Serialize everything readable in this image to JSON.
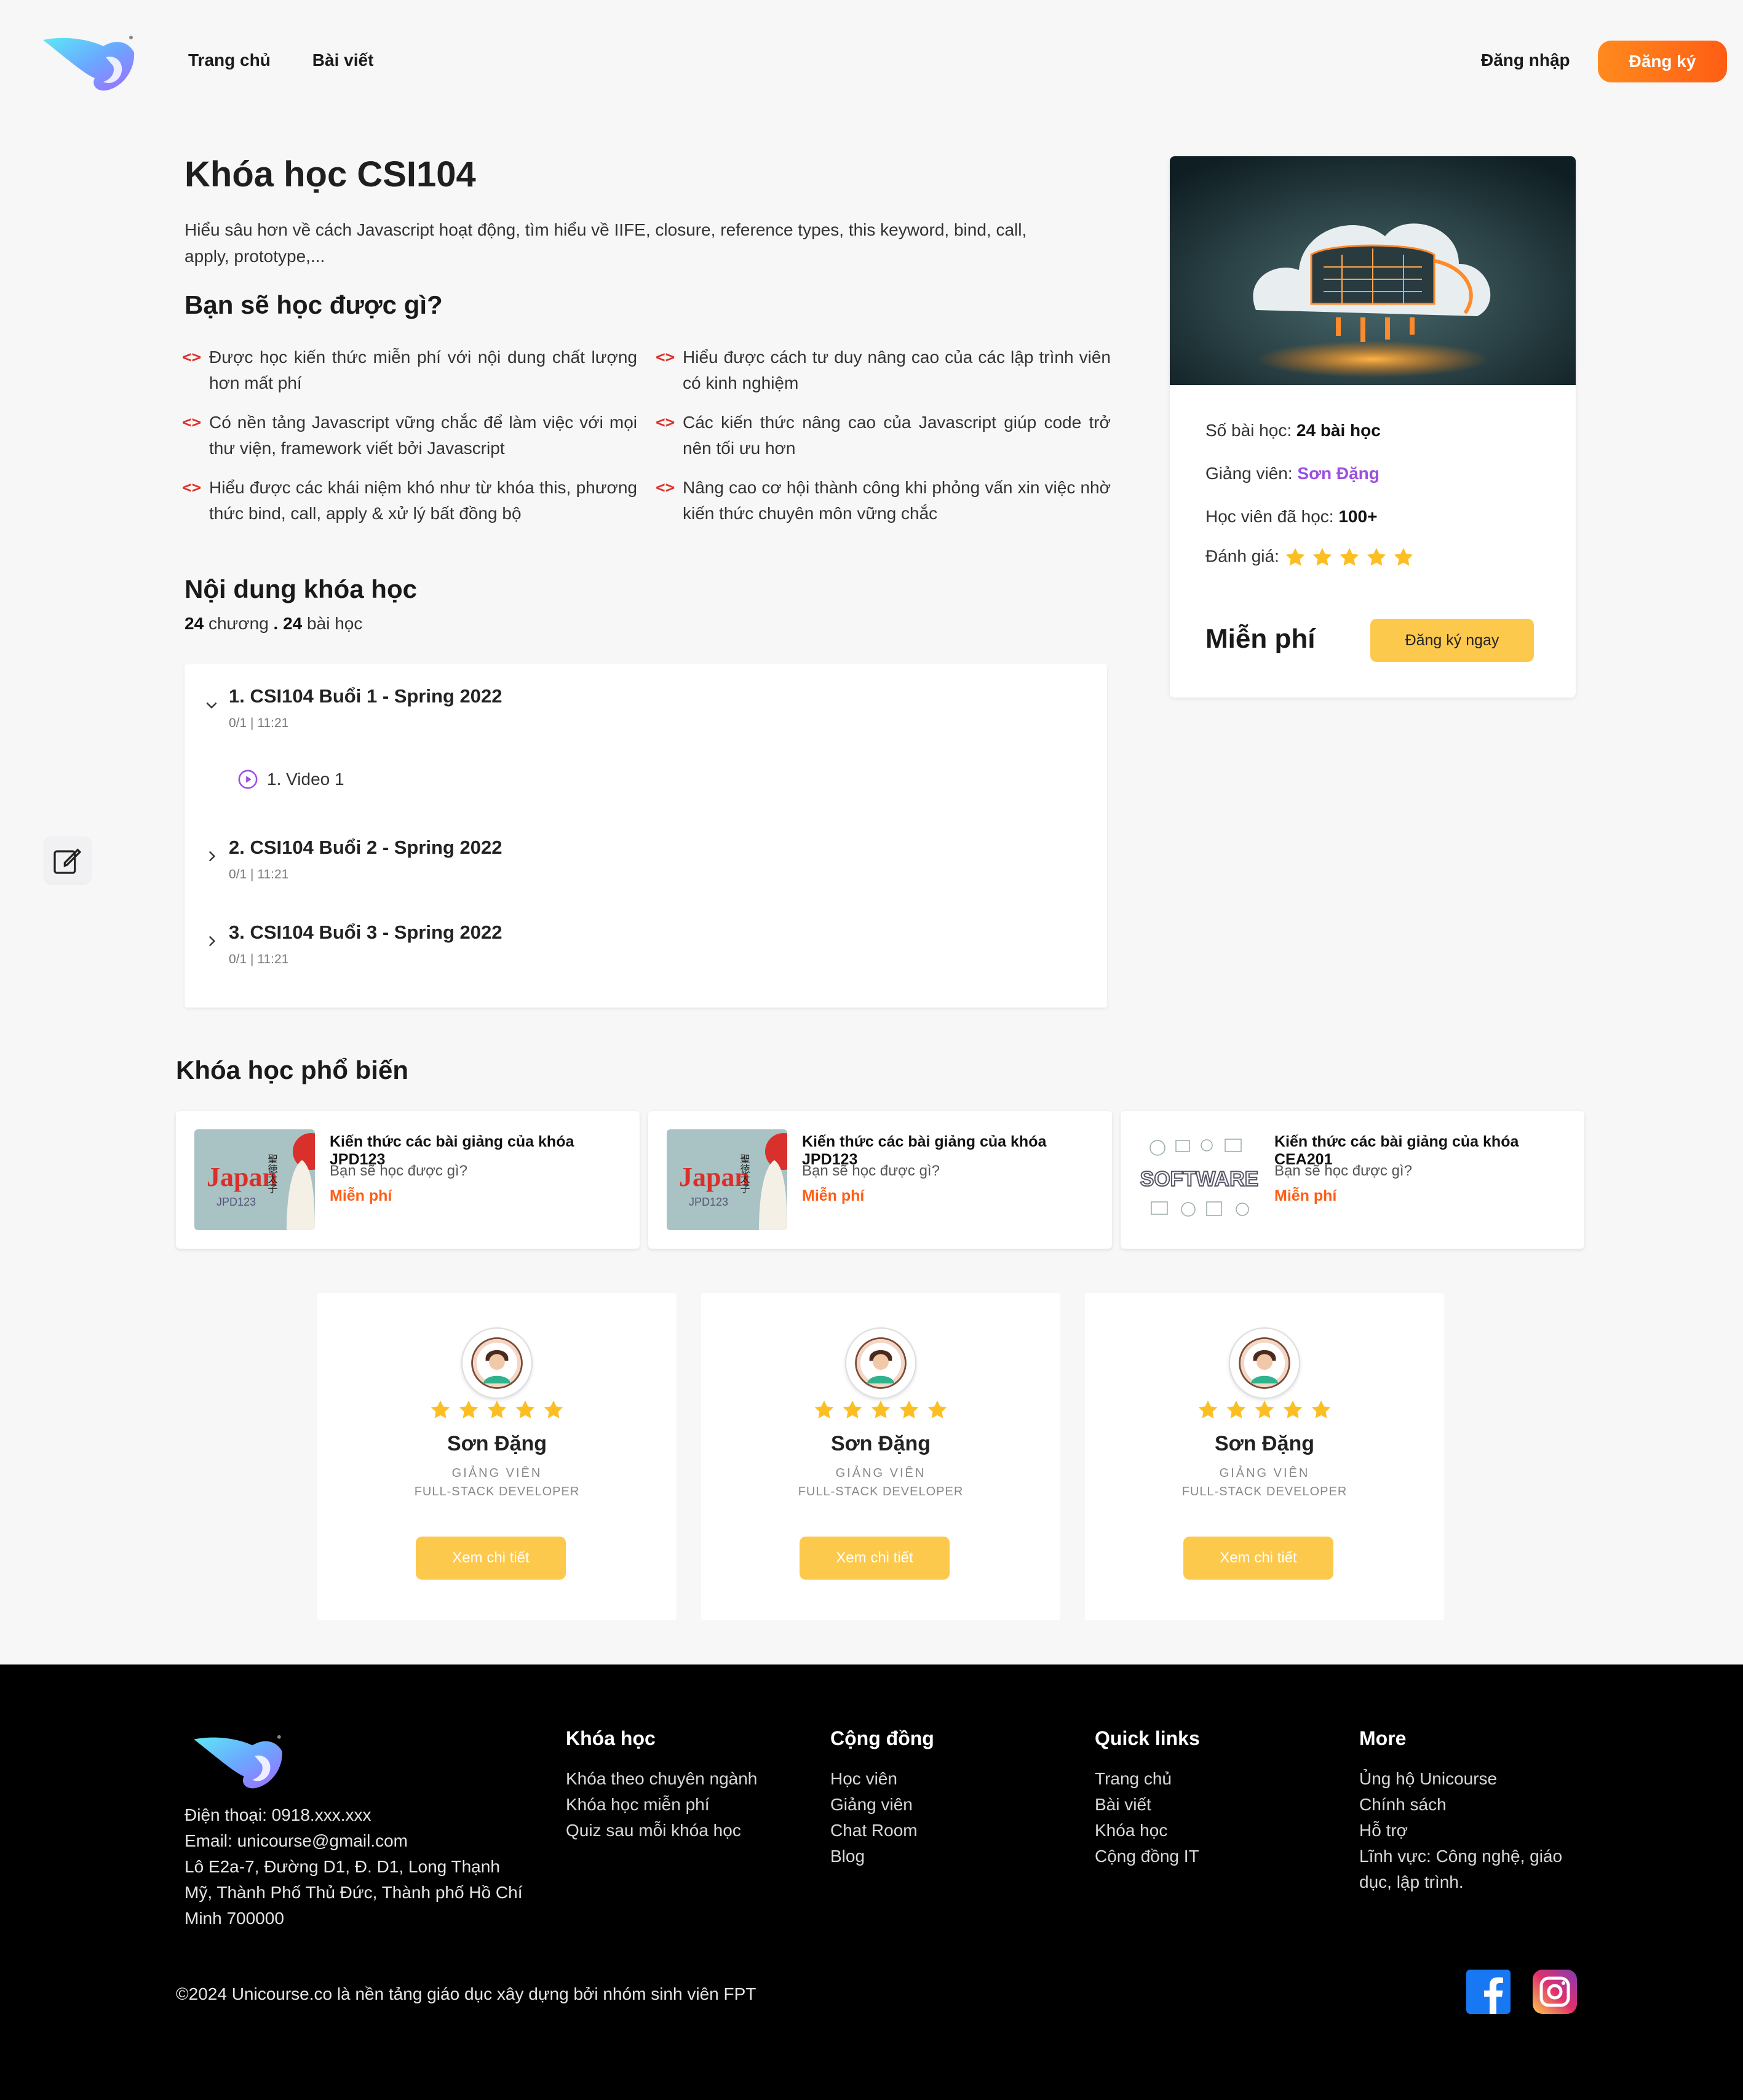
{
  "header": {
    "nav": [
      "Trang chủ",
      "Bài viết"
    ],
    "login": "Đăng nhập",
    "signup": "Đăng ký"
  },
  "course": {
    "title": "Khóa học CSI104",
    "description": "Hiểu sâu hơn về cách Javascript hoạt động, tìm hiểu về IIFE, closure, reference types, this keyword, bind, call, apply, prototype,...",
    "learn_heading": "Bạn sẽ học được gì?",
    "learn_items": [
      "Được học kiến thức miễn phí với nội dung chất lượng hơn mất phí",
      "Hiểu được cách tư duy nâng cao của các lập trình viên có kinh nghiệm",
      "Có nền tảng Javascript vững chắc để làm việc với mọi thư viện, framework viết bởi Javascript",
      "Các kiến thức nâng cao của Javascript giúp code trở nên tối ưu hơn",
      "Hiểu được các khái niệm khó như từ khóa this, phương thức bind, call, apply & xử lý bất đồng bộ",
      "Nâng cao cơ hội thành công khi phỏng vấn xin việc nhờ kiến thức chuyên môn vững chắc"
    ],
    "content_heading": "Nội dung khóa học",
    "chapter_count": "24",
    "chapter_word": "chương",
    "dot": ".",
    "lesson_count": "24",
    "lesson_word": "bài học",
    "chapters": [
      {
        "title": "1. CSI104 Buổi 1 - Spring 2022",
        "meta": "0/1 | 11:21"
      },
      {
        "title": "2. CSI104 Buổi 2 - Spring 2022",
        "meta": "0/1 | 11:21"
      },
      {
        "title": "3. CSI104 Buổi 3 - Spring 2022",
        "meta": "0/1 | 11:21"
      }
    ],
    "lesson": "1. Video 1"
  },
  "side_card": {
    "lessons_label": "Số bài học:",
    "lessons_value": "24 bài học",
    "teacher_label": "Giảng viên:",
    "teacher_value": "Sơn Đặng",
    "students_label": "Học viên đã học:",
    "students_value": "100+",
    "rating_label": "Đánh giá:",
    "rating": 5,
    "price": "Miễn phí",
    "enroll": "Đăng ký ngay"
  },
  "popular": {
    "heading": "Khóa học phổ biến",
    "items": [
      {
        "title": "Kiến thức các bài giảng của khóa JPD123",
        "sub": "Bạn sẽ học được gì?",
        "price": "Miễn phí",
        "thumb_text": "Japan",
        "thumb_code": "JPD123",
        "thumb_kanji": "聖徳太子"
      },
      {
        "title": "Kiến thức các bài giảng của khóa JPD123",
        "sub": "Bạn sẽ học được gì?",
        "price": "Miễn phí",
        "thumb_text": "Japan",
        "thumb_code": "JPD123",
        "thumb_kanji": "聖徳太子"
      },
      {
        "title": "Kiến thức các bài giảng của khóa CEA201",
        "sub": "Bạn sẽ học được gì?",
        "price": "Miễn phí",
        "thumb_text": "SOFTWARE"
      }
    ]
  },
  "teachers": [
    {
      "name": "Sơn Đặng",
      "role": "GIẢNG VIÊN",
      "job": "FULL-STACK DEVELOPER",
      "button": "Xem chi tiết",
      "rating": 5
    },
    {
      "name": "Sơn Đặng",
      "role": "GIẢNG VIÊN",
      "job": "FULL-STACK DEVELOPER",
      "button": "Xem chi tiết",
      "rating": 5
    },
    {
      "name": "Sơn Đặng",
      "role": "GIẢNG VIÊN",
      "job": "FULL-STACK DEVELOPER",
      "button": "Xem chi tiết",
      "rating": 5
    }
  ],
  "footer": {
    "contact": [
      "Điện thoại: 0918.xxx.xxx",
      "Email: unicourse@gmail.com",
      "Lô E2a-7, Đường D1, Đ. D1, Long Thạnh Mỹ, Thành Phố Thủ Đức, Thành phố Hồ Chí Minh 700000"
    ],
    "columns": [
      {
        "title": "Khóa học",
        "links": [
          "Khóa theo chuyên ngành",
          "Khóa học miễn phí",
          "Quiz sau mỗi khóa học"
        ]
      },
      {
        "title": "Cộng đồng",
        "links": [
          "Học viên",
          "Giảng viên",
          "Chat Room",
          "Blog"
        ]
      },
      {
        "title": "Quick links",
        "links": [
          "Trang chủ",
          "Bài viết",
          "Khóa học",
          "Cộng đồng IT"
        ]
      },
      {
        "title": "More",
        "links": [
          "Ủng hộ Unicourse",
          "Chính sách",
          "Hỗ trợ",
          "Lĩnh vực: Công nghệ, giáo dục, lập trình."
        ]
      }
    ],
    "copyright": "©2024 Unicourse.co là nền tảng giáo dục xây dựng bởi nhóm sinh viên FPT"
  },
  "colors": {
    "accent_orange": "#ff5d14",
    "accent_yellow": "#fdc94c",
    "teacher_purple": "#9b4fe0",
    "code_red": "#e0312b",
    "star": "#fbbf24"
  },
  "icons": {
    "logo": "unicorn-logo",
    "learn_bullet": "code-brackets-icon",
    "chapter_toggle": "chevron-icon",
    "lesson": "play-circle-icon",
    "fab": "edit-note-icon",
    "social": [
      "facebook-icon",
      "instagram-icon"
    ]
  }
}
